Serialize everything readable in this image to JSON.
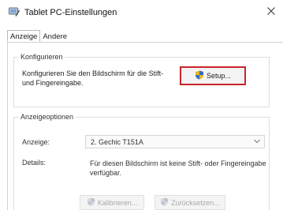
{
  "window": {
    "title": "Tablet PC-Einstellungen",
    "app_icon": "tablet-pc-icon",
    "close_icon": "close-icon"
  },
  "tabs": [
    {
      "label": "Anzeige",
      "active": true
    },
    {
      "label": "Andere",
      "active": false
    }
  ],
  "configure": {
    "legend": "Konfigurieren",
    "description": "Konfigurieren Sie den Bildschirm für die Stift- und Fingereingabe.",
    "setup_button": {
      "label": "Setup...",
      "icon": "shield-icon",
      "highlight_color": "#c8252c"
    }
  },
  "display_options": {
    "legend": "Anzeigeoptionen",
    "display_label": "Anzeige:",
    "display_value": "2. Gechic T151A",
    "details_label": "Details:",
    "details_text": "Für diesen Bildschirm ist keine Stift- oder Fingereingabe verfügbar.",
    "calibrate_button": {
      "label": "Kalibrieren...",
      "icon": "shield-icon",
      "enabled": false
    },
    "reset_button": {
      "label": "Zurücksetzen...",
      "icon": "shield-icon",
      "enabled": false
    }
  }
}
